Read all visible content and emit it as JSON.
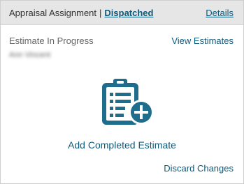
{
  "header": {
    "title": "Appraisal Assignment",
    "separator": "|",
    "status": "Dispatched",
    "details_label": "Details"
  },
  "estimate": {
    "label": "Estimate In Progress",
    "owner_name": "Ann Vincent",
    "view_link": "View Estimates"
  },
  "add": {
    "label": "Add Completed Estimate",
    "icon": "clipboard-add-icon"
  },
  "discard_label": "Discard Changes",
  "colors": {
    "accent": "#0e5a7b",
    "icon": "#1f6d8c",
    "header_bg": "#e6e6e6"
  }
}
